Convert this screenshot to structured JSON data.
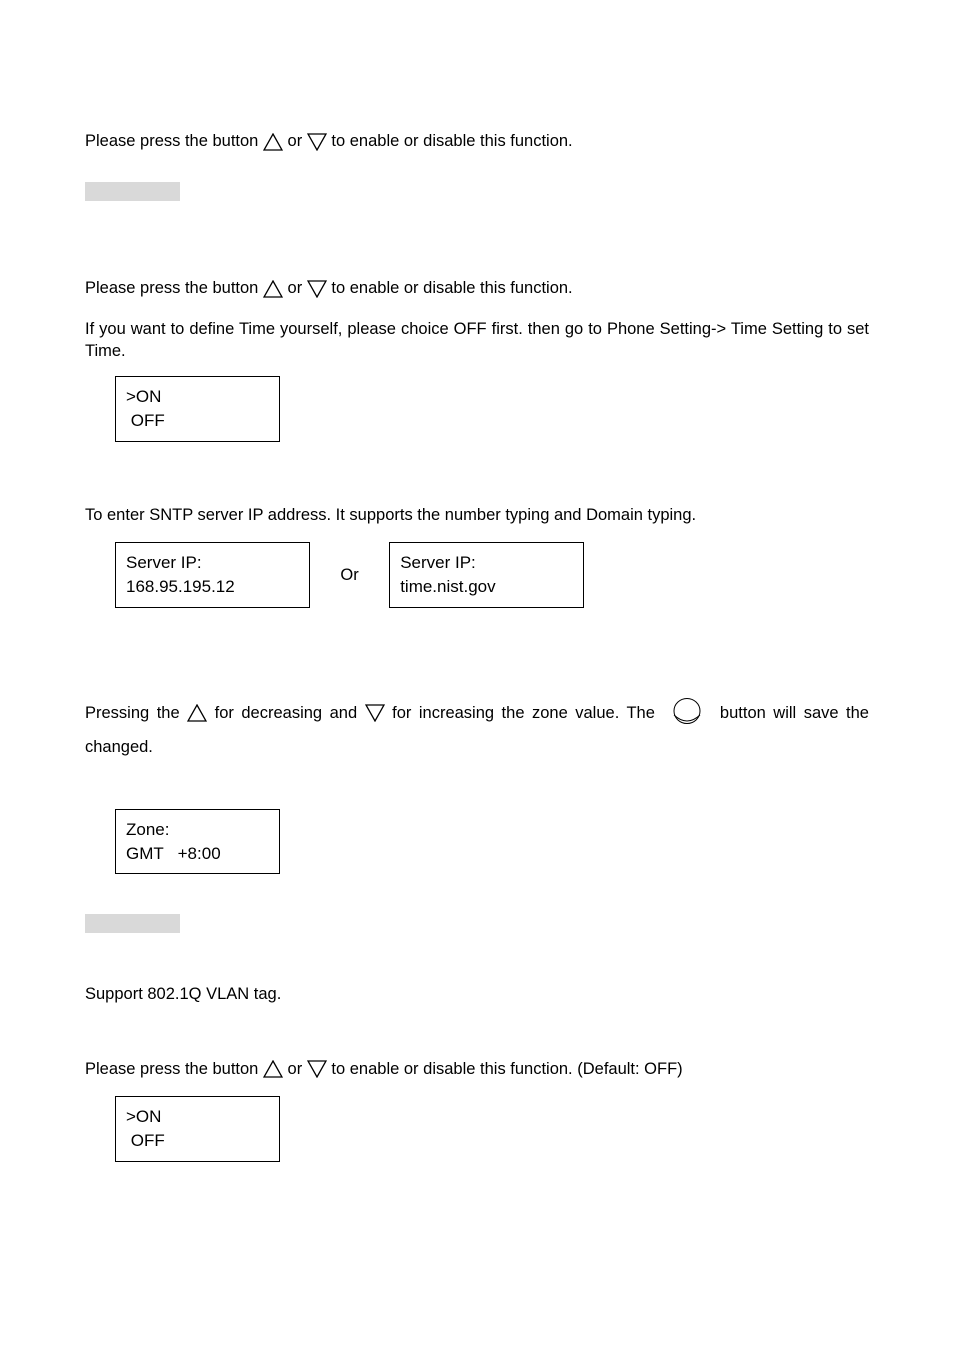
{
  "p1": {
    "a": "Please press the button ",
    "b": " or ",
    "c": " to enable or disable this function."
  },
  "p2": {
    "a": "Please press the button ",
    "b": " or ",
    "c": " to enable or disable this function."
  },
  "p3": "If you want to define Time yourself, please choice OFF first. then go to Phone Setting-> Time Setting to set Time.",
  "box1": {
    "l1": ">ON",
    "l2": " OFF"
  },
  "p4": "To enter SNTP server IP address. It supports the number typing and Domain typing.",
  "box2a": {
    "l1": "Server IP:",
    "l2": "168.95.195.12"
  },
  "orText": "Or",
  "box2b": {
    "l1": "Server IP:",
    "l2": "time.nist.gov"
  },
  "p5": {
    "a": "Pressing the ",
    "b": " for decreasing and ",
    "c": " for increasing the zone value. The ",
    "d": " button will save the changed."
  },
  "box3": {
    "l1": "Zone:",
    "l2": "GMT   +8:00"
  },
  "p6": "Support 802.1Q VLAN tag.",
  "p7": {
    "a": "Please press the button ",
    "b": " or ",
    "c": " to enable or disable this function. (Default: OFF)"
  },
  "box4": {
    "l1": ">ON",
    "l2": " OFF"
  }
}
